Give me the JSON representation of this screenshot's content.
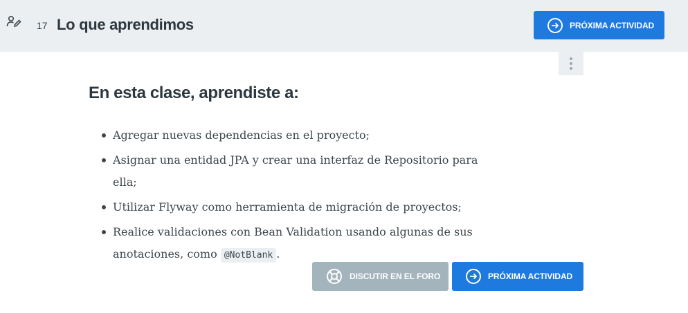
{
  "header": {
    "lesson_number": "17",
    "title": "Lo que aprendimos",
    "next_button": "PRÓXIMA ACTIVIDAD"
  },
  "content": {
    "title": "En esta clase, aprendiste a:",
    "items": [
      "Agregar nuevas dependencias en el proyecto;",
      "Asignar una entidad JPA y crear una interfaz de Repositorio para ella;",
      "Utilizar Flyway como herramienta de migración de proyectos;"
    ],
    "last_item": {
      "line1": "Realice validaciones con Bean Validation usando algunas de sus",
      "line2_prefix": "anotaciones, como",
      "code": "@NotBlank",
      "line2_suffix": "."
    }
  },
  "footer": {
    "forum_button": "DISCUTIR EN EL FORO",
    "next_button": "PRÓXIMA ACTIVIDAD"
  },
  "colors": {
    "primary": "#1f7ae0",
    "secondary": "#a3b4bd",
    "topbar": "#eceff1"
  },
  "icons": {
    "header_left": "user-edit-icon",
    "next": "arrow-right-circle-icon",
    "forum": "lifebuoy-icon",
    "menu": "kebab-menu-icon"
  }
}
